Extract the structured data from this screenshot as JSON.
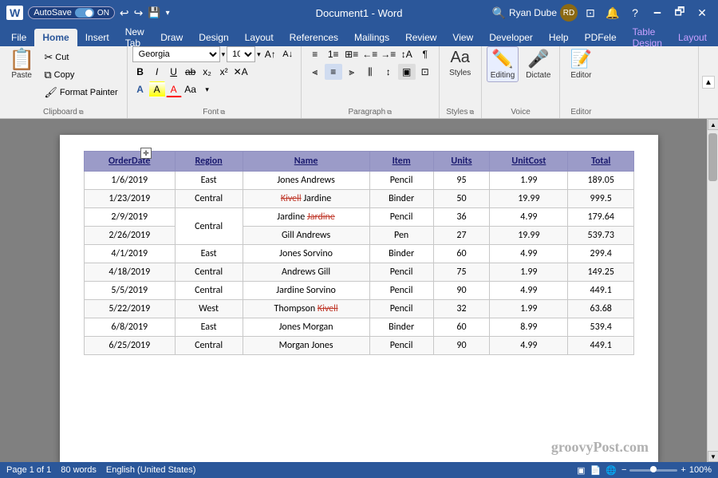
{
  "titleBar": {
    "autosave_label": "AutoSave",
    "autosave_state": "ON",
    "title": "Document1 - Word",
    "user_name": "Ryan Dube",
    "search_placeholder": "Search",
    "btn_minimize": "🗕",
    "btn_restore": "🗗",
    "btn_close": "✕"
  },
  "ribbonTabs": {
    "tabs": [
      {
        "label": "File",
        "id": "file"
      },
      {
        "label": "Home",
        "id": "home",
        "active": true
      },
      {
        "label": "Insert",
        "id": "insert"
      },
      {
        "label": "New Tab",
        "id": "newtab"
      },
      {
        "label": "Draw",
        "id": "draw"
      },
      {
        "label": "Design",
        "id": "design"
      },
      {
        "label": "Layout",
        "id": "layout"
      },
      {
        "label": "References",
        "id": "references"
      },
      {
        "label": "Mailings",
        "id": "mailings"
      },
      {
        "label": "Review",
        "id": "review"
      },
      {
        "label": "View",
        "id": "view"
      },
      {
        "label": "Developer",
        "id": "developer"
      },
      {
        "label": "Help",
        "id": "help"
      },
      {
        "label": "PDFele",
        "id": "pdfele"
      },
      {
        "label": "Table Design",
        "id": "tabledesign",
        "highlight": true
      },
      {
        "label": "Layout",
        "id": "layout2",
        "highlight": true
      }
    ]
  },
  "ribbon": {
    "clipboard": {
      "label": "Clipboard",
      "paste_label": "Paste",
      "cut_label": "Cut",
      "copy_label": "Copy",
      "format_painter_label": "Format Painter"
    },
    "font": {
      "label": "Font",
      "font_name": "Georgia",
      "font_size": "10",
      "bold": "B",
      "italic": "I",
      "underline": "U",
      "strikethrough": "ab",
      "subscript": "x₂",
      "superscript": "x²",
      "clear_format": "A",
      "font_color_label": "A",
      "highlight_label": "A",
      "text_effects_label": "A",
      "change_case_label": "Aa",
      "increase_size": "A↑",
      "decrease_size": "A↓"
    },
    "paragraph": {
      "label": "Paragraph"
    },
    "styles": {
      "label": "Styles",
      "styles_label": "Styles"
    },
    "voice": {
      "label": "Voice",
      "editing_label": "Editing",
      "dictate_label": "Dictate"
    },
    "editor": {
      "label": "Editor",
      "editor_label": "Editor"
    }
  },
  "table": {
    "headers": [
      "OrderDate",
      "Region",
      "Name",
      "Item",
      "Units",
      "UnitCost",
      "Total"
    ],
    "rows": [
      [
        "1/6/2019",
        "East",
        "Jones Andrews",
        "Pencil",
        "95",
        "1.99",
        "189.05"
      ],
      [
        "1/23/2019",
        "Central",
        "Kivell Jardine",
        "Binder",
        "50",
        "19.99",
        "999.5"
      ],
      [
        "2/9/2019",
        "",
        "Jardine Jardine",
        "Pencil",
        "36",
        "4.99",
        "179.64"
      ],
      [
        "2/26/2019",
        "Central",
        "Gill Andrews",
        "Pen",
        "27",
        "19.99",
        "539.73"
      ],
      [
        "4/1/2019",
        "East",
        "Jones Sorvino",
        "Binder",
        "60",
        "4.99",
        "299.4"
      ],
      [
        "4/18/2019",
        "Central",
        "Andrews Gill",
        "Pencil",
        "75",
        "1.99",
        "149.25"
      ],
      [
        "5/5/2019",
        "Central",
        "Jardine Sorvino",
        "Pencil",
        "90",
        "4.99",
        "449.1"
      ],
      [
        "5/22/2019",
        "West",
        "Thompson Kivell",
        "Pencil",
        "32",
        "1.99",
        "63.68"
      ],
      [
        "6/8/2019",
        "East",
        "Jones Morgan",
        "Binder",
        "60",
        "8.99",
        "539.4"
      ],
      [
        "6/25/2019",
        "Central",
        "Morgan Jones",
        "Pencil",
        "90",
        "4.99",
        "449.1"
      ]
    ],
    "strikethrough_cells": [
      {
        "row": 1,
        "col": 2,
        "first_word": "Kivell"
      },
      {
        "row": 2,
        "col": 2,
        "second_word": "Jardine"
      },
      {
        "row": 7,
        "col": 2,
        "second_word": "Kivell"
      }
    ]
  },
  "statusBar": {
    "page_info": "Page 1 of 1",
    "word_count": "80 words",
    "language": "English (United States)",
    "zoom_level": "100%"
  },
  "watermark": "groovyPost.com"
}
